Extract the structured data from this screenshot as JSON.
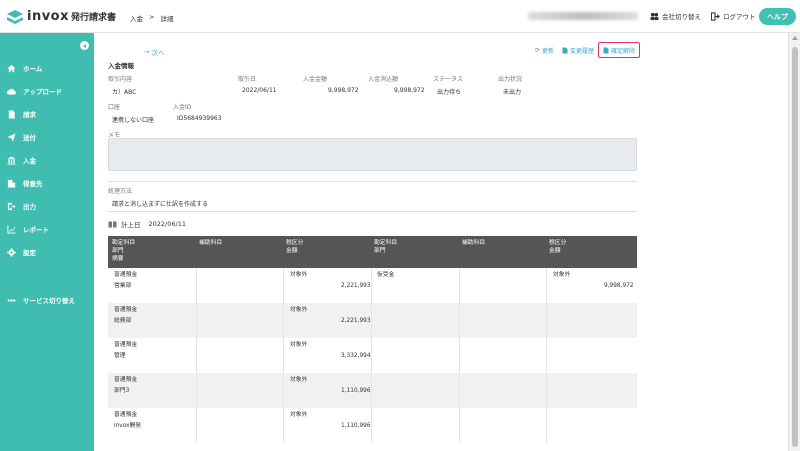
{
  "header": {
    "logo_text": "invox",
    "logo_sub": "発行請求書",
    "breadcrumb": [
      "入金",
      ">",
      "詳細"
    ],
    "switch_company": "会社切り替え",
    "logout": "ログアウト",
    "help": "ヘルプ"
  },
  "sidebar": {
    "items": [
      {
        "label": "ホーム",
        "icon": "home-icon"
      },
      {
        "label": "アップロード",
        "icon": "upload-icon"
      },
      {
        "label": "請求",
        "icon": "document-icon"
      },
      {
        "label": "送付",
        "icon": "send-icon"
      },
      {
        "label": "入金",
        "icon": "bank-icon"
      },
      {
        "label": "得意先",
        "icon": "building-icon"
      },
      {
        "label": "出力",
        "icon": "export-icon"
      },
      {
        "label": "レポート",
        "icon": "chart-icon"
      },
      {
        "label": "設定",
        "icon": "gear-icon"
      },
      {
        "label": "サービス切り替え",
        "icon": "switch-icon"
      }
    ]
  },
  "actions": {
    "next": "次へ",
    "update": "更新",
    "history": "変更履歴",
    "unconfirm": "確定解除"
  },
  "info": {
    "section_title": "入金情報",
    "fields": {
      "torihiki_label": "取引内容",
      "torihiki_value": "カ）ABC",
      "date_label": "取引日",
      "date_value": "2022/06/11",
      "amount_label": "入金金額",
      "amount_value": "9,998,972",
      "cleared_label": "入金消込額",
      "cleared_value": "9,998,972",
      "status_label": "ステータス",
      "status_value": "出力待ち",
      "output_label": "出力状況",
      "output_value": "未出力",
      "account_label": "口座",
      "account_value": "連携しない口座",
      "id_label": "入金ID",
      "id_value": "ID5684939963",
      "memo_label": "メモ",
      "method_label": "処理方法",
      "method_value": "請求と消し込まずに仕訳を作成する"
    }
  },
  "journal": {
    "date_label": "計上日",
    "date_value": "2022/06/11",
    "headers": {
      "debit_account": "勘定科目",
      "debit_dept": "部門",
      "debit_note": "摘要",
      "debit_sub": "補助科目",
      "debit_tax": "税区分",
      "debit_amount": "金額",
      "credit_account": "勘定科目",
      "credit_dept": "部門",
      "credit_sub": "補助科目",
      "credit_tax": "税区分",
      "credit_amount": "金額"
    },
    "rows": [
      {
        "account": "普通預金",
        "dept": "営業部",
        "tax": "対象外",
        "amount": "2,221,993",
        "c_account": "仮受金",
        "c_tax": "対象外",
        "c_amount": "9,998,972"
      },
      {
        "account": "普通預金",
        "dept": "総務部",
        "tax": "対象外",
        "amount": "2,221,993",
        "c_account": "",
        "c_tax": "",
        "c_amount": ""
      },
      {
        "account": "普通預金",
        "dept": "管理",
        "tax": "対象外",
        "amount": "3,332,994",
        "c_account": "",
        "c_tax": "",
        "c_amount": ""
      },
      {
        "account": "普通預金",
        "dept": "部門3",
        "tax": "対象外",
        "amount": "1,110,996",
        "c_account": "",
        "c_tax": "",
        "c_amount": ""
      },
      {
        "account": "普通預金",
        "dept": "invox開発",
        "tax": "対象外",
        "amount": "1,110,996",
        "c_account": "",
        "c_tax": "",
        "c_amount": ""
      }
    ]
  },
  "colors": {
    "brand": "#3fbdb1",
    "link": "#3fa8c8",
    "highlight": "#e0307a",
    "table_header": "#555555"
  }
}
